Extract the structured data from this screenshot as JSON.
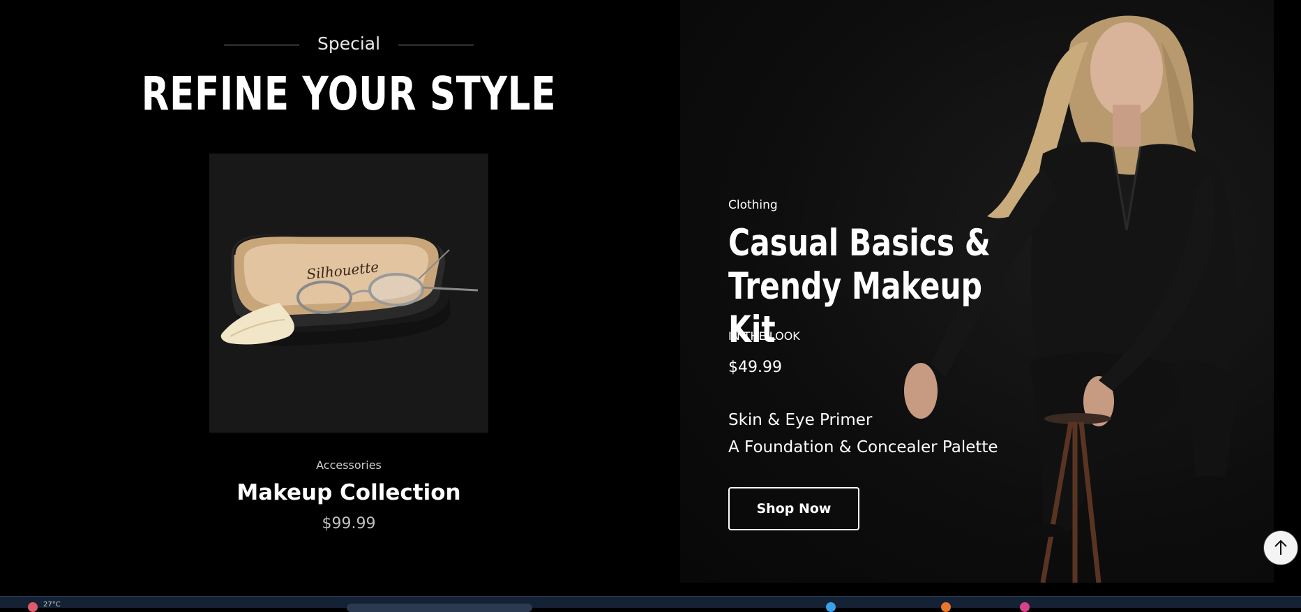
{
  "special_section": {
    "eyebrow": "Special",
    "title": "REFINE YOUR STYLE",
    "product": {
      "category": "Accessories",
      "name": "Makeup Collection",
      "price": "$99.99"
    }
  },
  "hero": {
    "category": "Clothing",
    "title_line1": "Casual Basics &",
    "title_line2": "Trendy Makeup Kit",
    "look_label": "IN THE LOOK",
    "price": "$49.99",
    "items": [
      "Skin & Eye Primer",
      "A Foundation & Concealer Palette"
    ],
    "shop_button": "Shop Now"
  },
  "scroll_top": {
    "icon": "arrow-up-icon"
  },
  "taskbar": {
    "weather_text": "27°C"
  },
  "colors": {
    "background": "#000000",
    "card": "#181818",
    "text": "#ffffff",
    "muted": "#c0c0c0"
  }
}
